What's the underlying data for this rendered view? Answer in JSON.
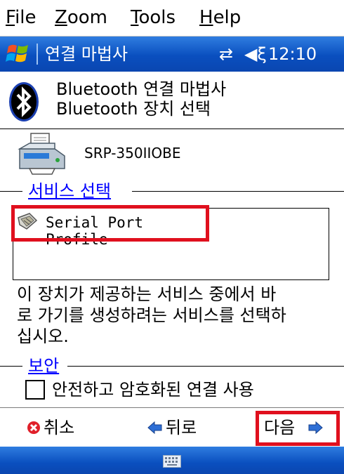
{
  "menu": {
    "file": {
      "accel": "F",
      "rest": "ile"
    },
    "zoom": {
      "accel": "Z",
      "rest": "oom"
    },
    "tools": {
      "accel": "T",
      "rest": "ools"
    },
    "help": {
      "accel": "H",
      "rest": "elp"
    }
  },
  "titlebar": {
    "title": "연결 마법사",
    "connectivity_icon": "⇄",
    "volume_icon": "◀ξ",
    "time": "12:10"
  },
  "header": {
    "title": "Bluetooth 연결 마법사",
    "subtitle": "Bluetooth 장치 선택"
  },
  "device": {
    "name": "SRP-350IIOBE"
  },
  "service_group": {
    "label": "서비스 선택",
    "items": [
      {
        "label": "Serial Port Profile",
        "icon": "plug-icon"
      }
    ]
  },
  "description": {
    "line1": "이 장치가 제공하는 서비스 중에서 바",
    "line2": "로 가기를 생성하려는 서비스를 선택하",
    "line3": "십시오."
  },
  "security_group": {
    "label": "보안",
    "checkbox_label": "안전하고 암호화된 연결 사용",
    "checked": false
  },
  "softkeys": {
    "cancel": "취소",
    "back": "뒤로",
    "next": "다음"
  },
  "colors": {
    "titlebar": "#0a4fbf",
    "highlight": "#e0101e",
    "group_label": "#0000ff"
  }
}
